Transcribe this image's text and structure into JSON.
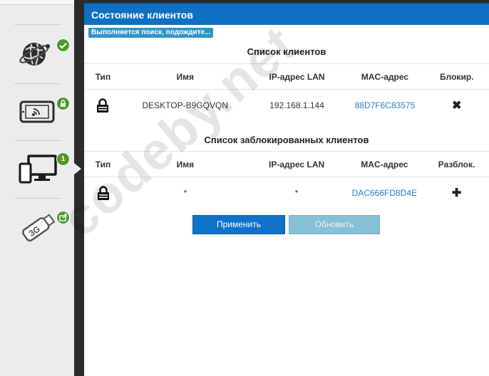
{
  "sidebar": {
    "items": [
      {
        "name": "internet",
        "icon": "globe-icon",
        "status": "check-icon"
      },
      {
        "name": "wifi",
        "icon": "tablet-wifi-icon",
        "status": "lock-icon"
      },
      {
        "name": "clients",
        "icon": "devices-icon",
        "count": "1",
        "selected": true
      },
      {
        "name": "usb-modem",
        "icon": "usb-3g-modem-icon",
        "status": "share-icon"
      }
    ]
  },
  "panel": {
    "title": "Состояние клиентов",
    "status_badge": "Выполняется поиск, подождите..."
  },
  "clients": {
    "title": "Список клиентов",
    "columns": [
      "Тип",
      "Имя",
      "IP-адрес LAN",
      "MAC-адрес",
      "Блокир."
    ],
    "rows": [
      {
        "type_icon": "lock-icon",
        "name": "DESKTOP-B9GQVQN",
        "ip": "192.168.1.144",
        "mac": "88D7F6C83575",
        "action": "✖"
      }
    ]
  },
  "blocked": {
    "title": "Список заблокированных клиентов",
    "columns": [
      "Тип",
      "Имя",
      "IP-адрес LAN",
      "MAC-адрес",
      "Разблок."
    ],
    "rows": [
      {
        "type_icon": "lock-icon",
        "name": "*",
        "ip": "*",
        "mac": "DAC666FD8D4E",
        "action": "✚"
      }
    ]
  },
  "buttons": {
    "apply": "Применить",
    "refresh": "Обновить"
  },
  "watermark": "codeby.net",
  "colors": {
    "header": "#0f70c2",
    "apply": "#1172c9",
    "refresh": "#86c0d6",
    "badge_green": "#4c9a2a",
    "link": "#2a7fc0"
  }
}
